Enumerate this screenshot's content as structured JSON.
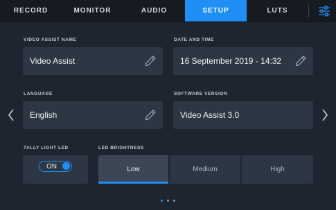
{
  "tabs": [
    {
      "label": "RECORD"
    },
    {
      "label": "MONITOR"
    },
    {
      "label": "AUDIO"
    },
    {
      "label": "SETUP"
    },
    {
      "label": "LUTS"
    }
  ],
  "active_tab": "SETUP",
  "settings_icon": "sliders-icon",
  "fields": {
    "video_assist_name": {
      "label": "VIDEO ASSIST NAME",
      "value": "Video Assist"
    },
    "date_time": {
      "label": "DATE AND TIME",
      "value": "16 September 2019 - 14:32"
    },
    "language": {
      "label": "LANGUAGE",
      "value": "English"
    },
    "software_version": {
      "label": "SOFTWARE VERSION",
      "value": "Video Assist 3.0"
    }
  },
  "tally": {
    "label": "TALLY LIGHT LED",
    "state": "ON"
  },
  "brightness": {
    "label": "LED BRIGHTNESS",
    "options": [
      "Low",
      "Medium",
      "High"
    ],
    "selected": "Low"
  },
  "pagination": {
    "pages": 3,
    "current": 1
  },
  "colors": {
    "accent": "#1f8ff5",
    "background": "#1f2530",
    "card": "#2d3643"
  }
}
